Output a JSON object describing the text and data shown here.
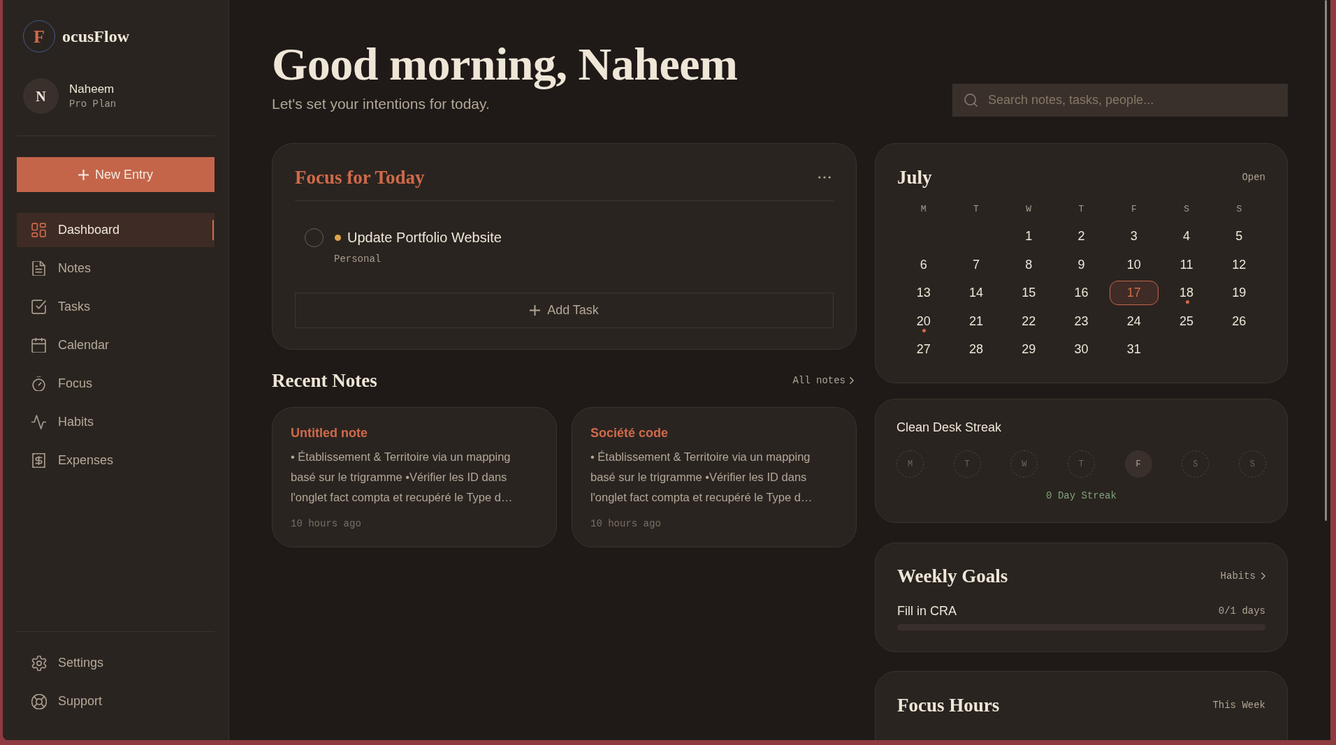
{
  "app": {
    "logo_letter": "F",
    "name": "ocusFlow"
  },
  "user": {
    "initial": "N",
    "name": "Naheem",
    "plan": "Pro Plan"
  },
  "new_entry_button": "New Entry",
  "nav": [
    {
      "label": "Dashboard",
      "selected": true
    },
    {
      "label": "Notes",
      "selected": false
    },
    {
      "label": "Tasks",
      "selected": false
    },
    {
      "label": "Calendar",
      "selected": false
    },
    {
      "label": "Focus",
      "selected": false
    },
    {
      "label": "Habits",
      "selected": false
    },
    {
      "label": "Expenses",
      "selected": false
    }
  ],
  "footer_nav": [
    {
      "label": "Settings"
    },
    {
      "label": "Support"
    }
  ],
  "greeting": {
    "title": "Good morning, Naheem",
    "subtitle": "Let's set your intentions for today."
  },
  "search": {
    "placeholder": "Search notes, tasks, people..."
  },
  "focus_today": {
    "title": "Focus for Today",
    "tasks": [
      {
        "title": "Update Portfolio Website",
        "category": "Personal",
        "checked": false,
        "color": "#dca54a"
      }
    ],
    "add_button": "Add Task"
  },
  "recent_notes": {
    "title": "Recent Notes",
    "link": "All notes",
    "notes": [
      {
        "title": "Untitled note",
        "excerpt": "• Établissement & Territoire via un mapping basé sur le trigramme •Vérifier les ID dans l'onglet fact compta et recupéré le Type d…",
        "time": "10 hours ago"
      },
      {
        "title": "Société code",
        "excerpt": "• Établissement & Territoire via un mapping basé sur le trigramme •Vérifier les ID dans l'onglet fact compta et recupéré le Type d…",
        "time": "10 hours ago"
      }
    ]
  },
  "calendar": {
    "month": "July",
    "open_link": "Open",
    "weekdays": [
      "M",
      "T",
      "W",
      "T",
      "F",
      "S",
      "S"
    ],
    "weeks": [
      {
        "days": [
          {
            "label": "1",
            "selected": false,
            "event": false
          },
          {
            "label": "2",
            "selected": false,
            "event": false
          },
          {
            "label": "3",
            "selected": false,
            "event": false
          },
          {
            "label": "4",
            "selected": false,
            "event": false
          },
          {
            "label": "5",
            "selected": false,
            "event": false
          }
        ]
      },
      {
        "days": [
          {
            "label": "6",
            "selected": false,
            "event": false
          },
          {
            "label": "7",
            "selected": false,
            "event": false
          },
          {
            "label": "8",
            "selected": false,
            "event": false
          },
          {
            "label": "9",
            "selected": false,
            "event": false
          },
          {
            "label": "10",
            "selected": false,
            "event": false
          },
          {
            "label": "11",
            "selected": false,
            "event": false
          },
          {
            "label": "12",
            "selected": false,
            "event": false
          }
        ]
      },
      {
        "days": [
          {
            "label": "13",
            "selected": false,
            "event": false
          },
          {
            "label": "14",
            "selected": false,
            "event": false
          },
          {
            "label": "15",
            "selected": false,
            "event": false
          },
          {
            "label": "16",
            "selected": false,
            "event": false
          },
          {
            "label": "17",
            "selected": true,
            "event": false
          },
          {
            "label": "18",
            "selected": false,
            "event": true
          },
          {
            "label": "19",
            "selected": false,
            "event": false
          }
        ]
      },
      {
        "days": [
          {
            "label": "20",
            "selected": false,
            "event": true
          },
          {
            "label": "21",
            "selected": false,
            "event": false
          },
          {
            "label": "22",
            "selected": false,
            "event": false
          },
          {
            "label": "23",
            "selected": false,
            "event": false
          },
          {
            "label": "24",
            "selected": false,
            "event": false
          },
          {
            "label": "25",
            "selected": false,
            "event": false
          },
          {
            "label": "26",
            "selected": false,
            "event": false
          }
        ]
      },
      {
        "days": [
          {
            "label": "27",
            "selected": false,
            "event": false
          },
          {
            "label": "28",
            "selected": false,
            "event": false
          },
          {
            "label": "29",
            "selected": false,
            "event": false
          },
          {
            "label": "30",
            "selected": false,
            "event": false
          },
          {
            "label": "31",
            "selected": false,
            "event": false
          }
        ]
      }
    ]
  },
  "streak": {
    "title": "Clean Desk Streak",
    "days": [
      {
        "label": "M",
        "done": false,
        "current": false
      },
      {
        "label": "T",
        "done": false,
        "current": false
      },
      {
        "label": "W",
        "done": false,
        "current": false
      },
      {
        "label": "T",
        "done": false,
        "current": false
      },
      {
        "label": "F",
        "done": false,
        "current": true
      },
      {
        "label": "S",
        "done": false,
        "current": false
      },
      {
        "label": "S",
        "done": false,
        "current": false
      }
    ],
    "summary": "0 Day Streak"
  },
  "weekly_goals": {
    "title": "Weekly Goals",
    "link": "Habits",
    "goals": [
      {
        "name": "Fill in CRA",
        "progress": "0/1 days",
        "level": 0
      }
    ]
  },
  "focus_hours": {
    "title": "Focus Hours",
    "range": "This Week"
  }
}
